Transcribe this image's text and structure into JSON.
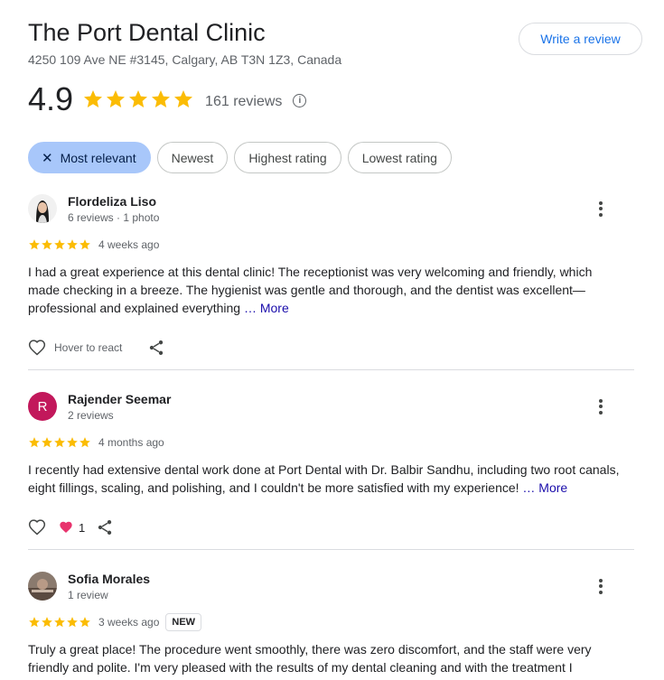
{
  "place": {
    "name": "The Port Dental Clinic",
    "address": "4250 109 Ave NE #3145, Calgary, AB T3N 1Z3, Canada",
    "write_review_label": "Write a review",
    "rating": "4.9",
    "reviews_count": "161 reviews",
    "info_glyph": "i"
  },
  "filters": [
    {
      "label": "Most relevant",
      "active": true
    },
    {
      "label": "Newest",
      "active": false
    },
    {
      "label": "Highest rating",
      "active": false
    },
    {
      "label": "Lowest rating",
      "active": false
    }
  ],
  "filter_close_glyph": "✕",
  "colors": {
    "star": "#fbbc04",
    "accent": "#1a73e8",
    "chip_active": "#a8c7fa",
    "heart": "#e8336d"
  },
  "reviews": [
    {
      "name": "Flordeliza Liso",
      "meta": "6 reviews · 1 photo",
      "stars": 5,
      "age": "4 weeks ago",
      "text": "I had a great experience at this dental clinic! The receptionist was very welcoming and friendly, which made checking in a breeze. The hygienist was gentle and thorough, and the dentist was excellent—professional and explained everything",
      "more": "… More",
      "react_label": "Hover to react",
      "avatar_icon": "person-photo"
    },
    {
      "name": "Rajender Seemar",
      "meta": "2 reviews",
      "stars": 5,
      "age": "4 months ago",
      "text": "I recently had extensive dental work done at Port Dental with Dr. Balbir Sandhu, including two root canals, eight fillings, scaling, and polishing, and I couldn't be more satisfied with my experience!",
      "more": "… More",
      "avatar_letter": "R",
      "likes": "1"
    },
    {
      "name": "Sofia Morales",
      "meta": "1 review",
      "stars": 5,
      "age": "3 weeks ago",
      "badge": "NEW",
      "text": "Truly a great place! The procedure went smoothly, there was zero discomfort, and the staff were very friendly and polite. I'm very pleased with the results of my dental cleaning and with the treatment I",
      "avatar_icon": "person-photo"
    }
  ]
}
